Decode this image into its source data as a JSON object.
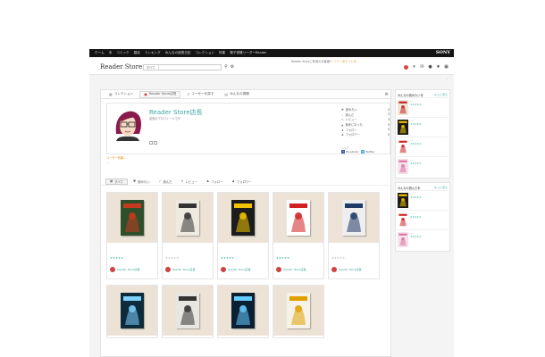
{
  "topbar": {
    "nav": [
      "ホーム",
      "本",
      "コミック",
      "雑誌",
      "ランキング",
      "みんなの読書日記",
      "コレクション",
      "特集",
      "電子書籍リーダーReader"
    ],
    "brand": "SONY"
  },
  "header": {
    "logo": "Reader Store",
    "notice_prefix": "Reader Storeご利用のお客様へ",
    "notice_link": "ソニーポイントの…",
    "search_scope": "すべて",
    "search_placeholder": "",
    "sublink": "…"
  },
  "tabs": [
    {
      "label": "コレクション",
      "icon": "collection-icon"
    },
    {
      "label": "Reader Store店長",
      "icon": "avatar-icon"
    },
    {
      "label": "ユーザーを探す",
      "icon": "search-icon"
    },
    {
      "label": "みんなの書棚",
      "icon": "shelf-icon"
    }
  ],
  "profile": {
    "name": "Reader Store店長",
    "desc": "店長のプロフィールです",
    "meta": "…",
    "stats": [
      {
        "label": "読みたい",
        "value": "5",
        "icon": "heart-icon"
      },
      {
        "label": "読んだ",
        "value": "2",
        "icon": "check-icon"
      },
      {
        "label": "レビュー",
        "value": "3",
        "icon": "pencil-icon"
      },
      {
        "label": "参考になった",
        "value": "0",
        "icon": "thumb-icon"
      },
      {
        "label": "フォロー",
        "value": "0",
        "icon": "follow-icon"
      },
      {
        "label": "フォロワー",
        "value": "0",
        "icon": "follower-icon"
      }
    ],
    "share_label": "シェア",
    "share": [
      {
        "label": "Facebook",
        "color": "#3b5998"
      },
      {
        "label": "Twitter",
        "color": "#55acee"
      }
    ]
  },
  "warning": {
    "line1": "ユーザー情報…",
    "line2": "…"
  },
  "filters": [
    {
      "label": "すべて",
      "icon": "all-icon"
    },
    {
      "label": "読みたい",
      "icon": "heart-icon"
    },
    {
      "label": "読んだ",
      "icon": "check-icon"
    },
    {
      "label": "レビュー",
      "icon": "pencil-icon"
    },
    {
      "label": "フォロー",
      "icon": "follow-icon"
    },
    {
      "label": "フォロワー",
      "icon": "follower-icon"
    }
  ],
  "books": [
    {
      "title": "",
      "author": "",
      "stars": "★★★★★",
      "user": "Reader Store店長",
      "date": "",
      "cover_bg": "#2f4f2a",
      "cover_fg": "#c43a1e"
    },
    {
      "title": "",
      "author": "",
      "stars": "★★★★★",
      "user": "Reader Store店長",
      "date": "",
      "cover_bg": "#efeae0",
      "cover_fg": "#333333"
    },
    {
      "title": "",
      "author": "",
      "stars": "★★★★★",
      "user": "Reader Store店長",
      "date": "",
      "cover_bg": "#1c1c1c",
      "cover_fg": "#f2c400"
    },
    {
      "title": "",
      "author": "",
      "stars": "★★★★★",
      "user": "Reader Store店長",
      "date": "",
      "cover_bg": "#ffffff",
      "cover_fg": "#d22020"
    },
    {
      "title": "",
      "author": "",
      "stars": "★★★★★",
      "user": "Reader Store店長",
      "date": "",
      "cover_bg": "#eeeeee",
      "cover_fg": "#1f3b66"
    },
    {
      "cover_bg": "#0e2b3c",
      "cover_fg": "#7fd0ff"
    },
    {
      "cover_bg": "#e8e6e0",
      "cover_fg": "#333333"
    },
    {
      "cover_bg": "#0b1f33",
      "cover_fg": "#66ccff"
    },
    {
      "cover_bg": "#f6f2e8",
      "cover_fg": "#e0a000"
    }
  ],
  "sidebar": {
    "panels": [
      {
        "title": "みんなの読みたい本",
        "more": "もっと見る",
        "items": [
          {
            "text": "…",
            "stars": "★★★★★",
            "bg": "#f1e6d8",
            "fg": "#c02020"
          },
          {
            "text": "…",
            "stars": "★★★★★",
            "bg": "#1a1a1a",
            "fg": "#f2c400"
          },
          {
            "text": "…",
            "stars": "★★★★★",
            "bg": "#ffffff",
            "fg": "#d22020"
          },
          {
            "text": "…",
            "stars": "★★★★★",
            "bg": "#f4e2ec",
            "fg": "#e070a0"
          }
        ]
      },
      {
        "title": "みんなの読んだ本",
        "more": "もっと見る",
        "items": [
          {
            "text": "…",
            "stars": "★★★★★",
            "bg": "#1a1a1a",
            "fg": "#f2c400"
          },
          {
            "text": "…",
            "stars": "★★★★★",
            "bg": "#ffffff",
            "fg": "#d22020"
          },
          {
            "text": "…",
            "stars": "★★★★★",
            "bg": "#f4e2ec",
            "fg": "#e070a0"
          }
        ]
      }
    ]
  },
  "colors": {
    "accent": "#3aa7a0",
    "warning": "#e58a00",
    "topbar": "#141414"
  }
}
